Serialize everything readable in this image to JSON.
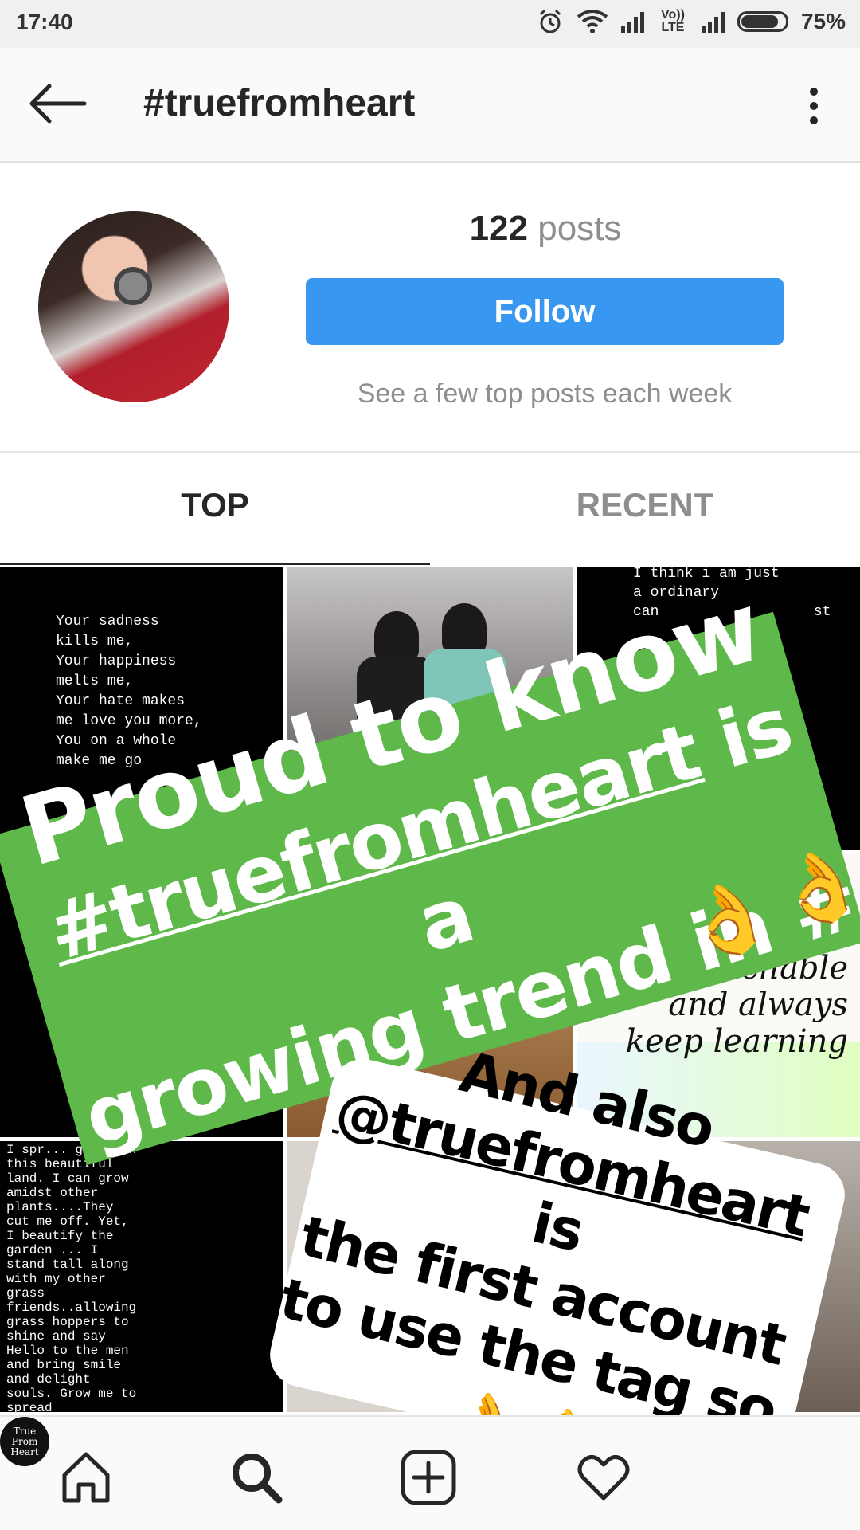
{
  "status_bar": {
    "time": "17:40",
    "network_label": "Vo)) LTE",
    "battery": "75%"
  },
  "header": {
    "title": "#truefromheart"
  },
  "profile": {
    "post_count": "122",
    "post_label": "posts",
    "follow_label": "Follow",
    "subtitle": "See a few top posts each week"
  },
  "tabs": {
    "top": "TOP",
    "recent": "RECENT",
    "active": "TOP"
  },
  "grid": {
    "post1_text": "Your sadness\nkills me,\nYour happiness\nmelts me,\nYour hate makes\nme love you more,\nYou on a whole\nmake me go",
    "post3_text": "I think i am just\na ordinary\ncan                  st",
    "post6_text": "be teachable\nand always\nkeep learning",
    "post7_text": "I spr... green on\nthis beautiful\nland. I can grow\namidst other\nplants....They\ncut me off. Yet,\nI beautify the\ngarden ... I\nstand tall along\nwith my other\ngrass\nfriends..allowing\ngrass hoppers to\nshine and say\nHello to the men\nand bring smile\nand delight\nsouls. Grow me to\nspread"
  },
  "story_overlay": {
    "green_line1": "Proud to know",
    "green_line2_tag": "#truefromheart",
    "green_line2_rest": " is a",
    "green_line3": "growing trend in #",
    "white_line1": "And also",
    "white_line2_tag": "@truefromheart",
    "white_line2_rest": " is",
    "white_line3": "the first account",
    "white_line4": "to use the tag so",
    "emoji": "👌"
  },
  "bottom_nav": {
    "items": [
      "home-icon",
      "search-icon",
      "add-post-icon",
      "heart-icon",
      "profile-avatar"
    ],
    "profile_avatar_text": "True\nFrom\nHeart"
  },
  "colors": {
    "follow_button": "#3897f0",
    "green_sticker": "#5eb94a",
    "active_tab": "#262626",
    "inactive_tab": "#8e8e8e"
  }
}
